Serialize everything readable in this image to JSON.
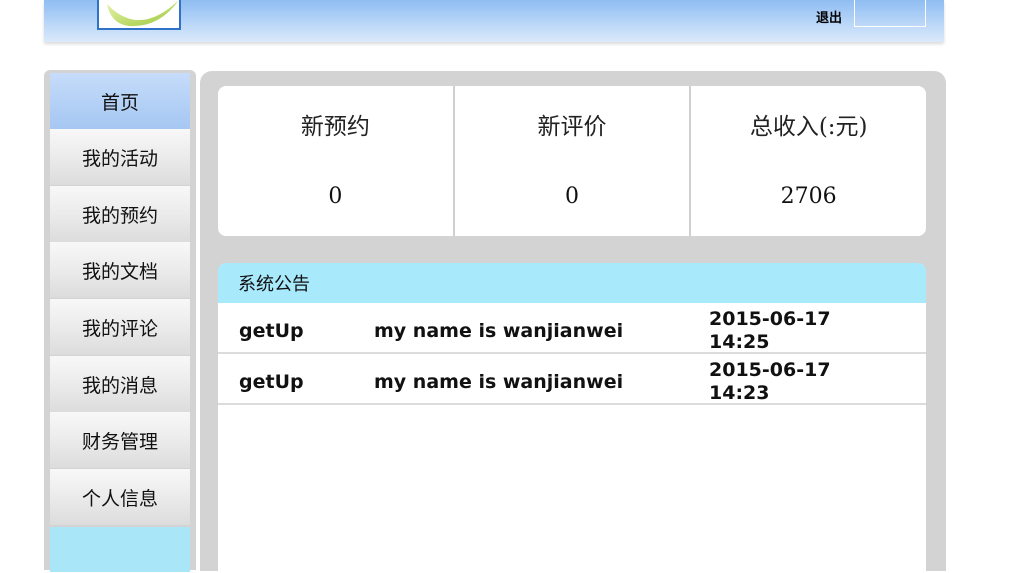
{
  "header": {
    "logout_label": "退出"
  },
  "sidebar": {
    "items": [
      {
        "label": "首页",
        "active": true
      },
      {
        "label": "我的活动"
      },
      {
        "label": "我的预约"
      },
      {
        "label": "我的文档"
      },
      {
        "label": "我的评论"
      },
      {
        "label": "我的消息"
      },
      {
        "label": "财务管理"
      },
      {
        "label": "个人信息"
      }
    ]
  },
  "stats": [
    {
      "label": "新预约",
      "value": "0"
    },
    {
      "label": "新评价",
      "value": "0"
    },
    {
      "label": "总收入(:元)",
      "value": "2706"
    }
  ],
  "notice": {
    "title": "系统公告",
    "rows": [
      {
        "type": "getUp",
        "content": "my name is wanjianwei",
        "time": "2015-06-17 14:25"
      },
      {
        "type": "getUp",
        "content": "my name is wanjianwei",
        "time": "2015-06-17 14:23"
      }
    ]
  },
  "colors": {
    "header_gradient_top": "#8fbdf2",
    "nav_active": "#a5c7f2",
    "notice_header": "#a8e9fb",
    "panel_gray": "#d3d3d3"
  }
}
